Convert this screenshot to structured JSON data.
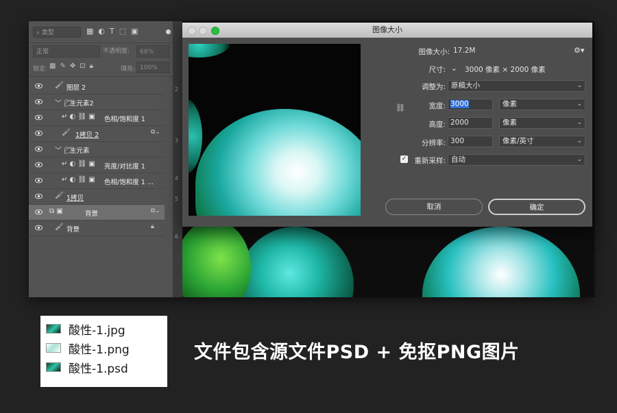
{
  "layers_panel": {
    "filter_label": "类型",
    "blend_mode": "正常",
    "opacity_label": "不透明度:",
    "opacity_value": "68%",
    "lock_label": "锁定:",
    "fill_label": "填充:",
    "fill_value": "100%",
    "layers": [
      {
        "name": "图层 2",
        "type": "brush"
      },
      {
        "name": "主元素2",
        "type": "group"
      },
      {
        "name": "色相/饱和度 1",
        "type": "adjustment"
      },
      {
        "name": "1拷贝 2",
        "type": "smart"
      },
      {
        "name": "主元素",
        "type": "group"
      },
      {
        "name": "亮度/对比度 1",
        "type": "adjustment"
      },
      {
        "name": "色相/饱和度 1 ...",
        "type": "adjustment"
      },
      {
        "name": "1拷贝",
        "type": "brush"
      },
      {
        "name": "背景",
        "type": "smart-selected"
      },
      {
        "name": "背景",
        "type": "brush-locked"
      }
    ]
  },
  "rulers": [
    "2",
    "3",
    "4",
    "5",
    "6"
  ],
  "dialog": {
    "title": "图像大小",
    "image_size_label": "图像大小:",
    "image_size_value": "17.2M",
    "dimensions_label": "尺寸:",
    "dimensions_value": "3000 像素 × 2000 像素",
    "fit_to_label": "调整为:",
    "fit_to_value": "原稿大小",
    "width_label": "宽度:",
    "width_value": "3000",
    "width_unit": "像素",
    "height_label": "高度:",
    "height_value": "2000",
    "height_unit": "像素",
    "resolution_label": "分辨率:",
    "resolution_value": "300",
    "resolution_unit": "像素/英寸",
    "resample_label": "重新采样:",
    "resample_value": "自动",
    "resample_checked": true,
    "cancel_label": "取消",
    "ok_label": "确定"
  },
  "files": [
    {
      "name": "酸性-1.jpg",
      "icon": "jpg-thumbnail-icon"
    },
    {
      "name": "酸性-1.png",
      "icon": "png-thumbnail-icon"
    },
    {
      "name": "酸性-1.psd",
      "icon": "psd-thumbnail-icon"
    }
  ],
  "caption": "文件包含源文件PSD + 免抠PNG图片",
  "colors": {
    "accent": "#2f6fd6",
    "background": "#222222",
    "panel": "#535353",
    "dialog": "#4d4d4d"
  }
}
